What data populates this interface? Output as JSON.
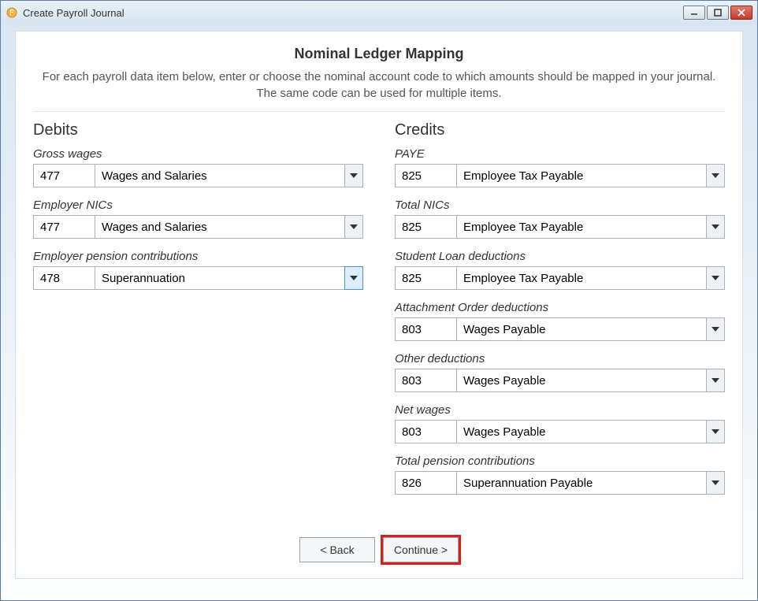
{
  "window": {
    "title": "Create Payroll Journal"
  },
  "page": {
    "title": "Nominal Ledger Mapping",
    "desc1": "For each payroll data item below, enter or choose the nominal account code to which amounts should be mapped in your journal.",
    "desc2": "The same code can be used for multiple items."
  },
  "debits": {
    "heading": "Debits",
    "items": [
      {
        "label": "Gross wages",
        "code": "477",
        "name": "Wages and Salaries",
        "hot": false
      },
      {
        "label": "Employer NICs",
        "code": "477",
        "name": "Wages and Salaries",
        "hot": false
      },
      {
        "label": "Employer pension contributions",
        "code": "478",
        "name": "Superannuation",
        "hot": true
      }
    ]
  },
  "credits": {
    "heading": "Credits",
    "items": [
      {
        "label": "PAYE",
        "code": "825",
        "name": "Employee Tax Payable",
        "hot": false
      },
      {
        "label": "Total NICs",
        "code": "825",
        "name": "Employee Tax Payable",
        "hot": false
      },
      {
        "label": "Student Loan deductions",
        "code": "825",
        "name": "Employee Tax Payable",
        "hot": false
      },
      {
        "label": "Attachment Order deductions",
        "code": "803",
        "name": "Wages Payable",
        "hot": false
      },
      {
        "label": "Other deductions",
        "code": "803",
        "name": "Wages Payable",
        "hot": false
      },
      {
        "label": "Net wages",
        "code": "803",
        "name": "Wages Payable",
        "hot": false
      },
      {
        "label": "Total pension contributions",
        "code": "826",
        "name": "Superannuation Payable",
        "hot": false
      }
    ]
  },
  "footer": {
    "back": "< Back",
    "continue": "Continue >"
  }
}
